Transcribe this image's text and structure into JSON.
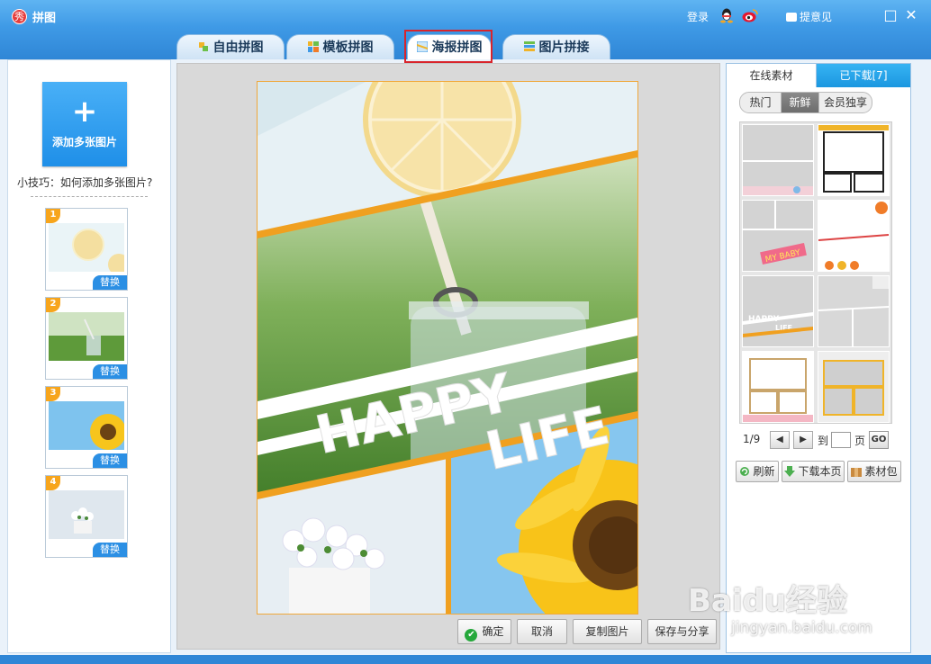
{
  "app": {
    "title": "拼图",
    "icon_char": "秀"
  },
  "topbar": {
    "login": "登录",
    "feedback": "提意见",
    "minimize": "□",
    "close": "✕"
  },
  "tabs": [
    {
      "label": "自由拼图",
      "icon": "free-collage-icon"
    },
    {
      "label": "模板拼图",
      "icon": "template-icon"
    },
    {
      "label": "海报拼图",
      "icon": "poster-icon",
      "active": true
    },
    {
      "label": "图片拼接",
      "icon": "stitch-icon"
    }
  ],
  "left": {
    "add_label": "添加多张图片",
    "add_plus": "+",
    "tip": "小技巧：如何添加多张图片?",
    "thumbs": [
      {
        "num": "1",
        "replace": "替换"
      },
      {
        "num": "2",
        "replace": "替换"
      },
      {
        "num": "3",
        "replace": "替换"
      },
      {
        "num": "4",
        "replace": "替换"
      }
    ]
  },
  "poster": {
    "text1": "HAPPY",
    "text2": "LIFE"
  },
  "bottom": {
    "confirm": "确定",
    "cancel": "取消",
    "copy": "复制图片",
    "save": "保存与分享",
    "check": "✔"
  },
  "right": {
    "tab_online": "在线素材",
    "tab_downloaded": "已下载[7]",
    "subtabs": [
      "热门",
      "新鲜",
      "会员独享"
    ],
    "template_text_baby": "MY BABY",
    "template_text_happy": "HAPPY",
    "template_text_life": "LIFE",
    "page_indicator": "1/9",
    "prev": "◀",
    "next": "▶",
    "goto_label": "到",
    "page_label": "页",
    "go": "GO",
    "refresh": "刷新",
    "download_page": "下载本页",
    "material_pack": "素材包"
  },
  "watermark": {
    "brand": "Baidu经验",
    "url": "jingyan.baidu.com"
  },
  "colors": {
    "accent": "#2b8ad6",
    "highlight": "#d9242b",
    "poster_border": "#f0a83a"
  }
}
